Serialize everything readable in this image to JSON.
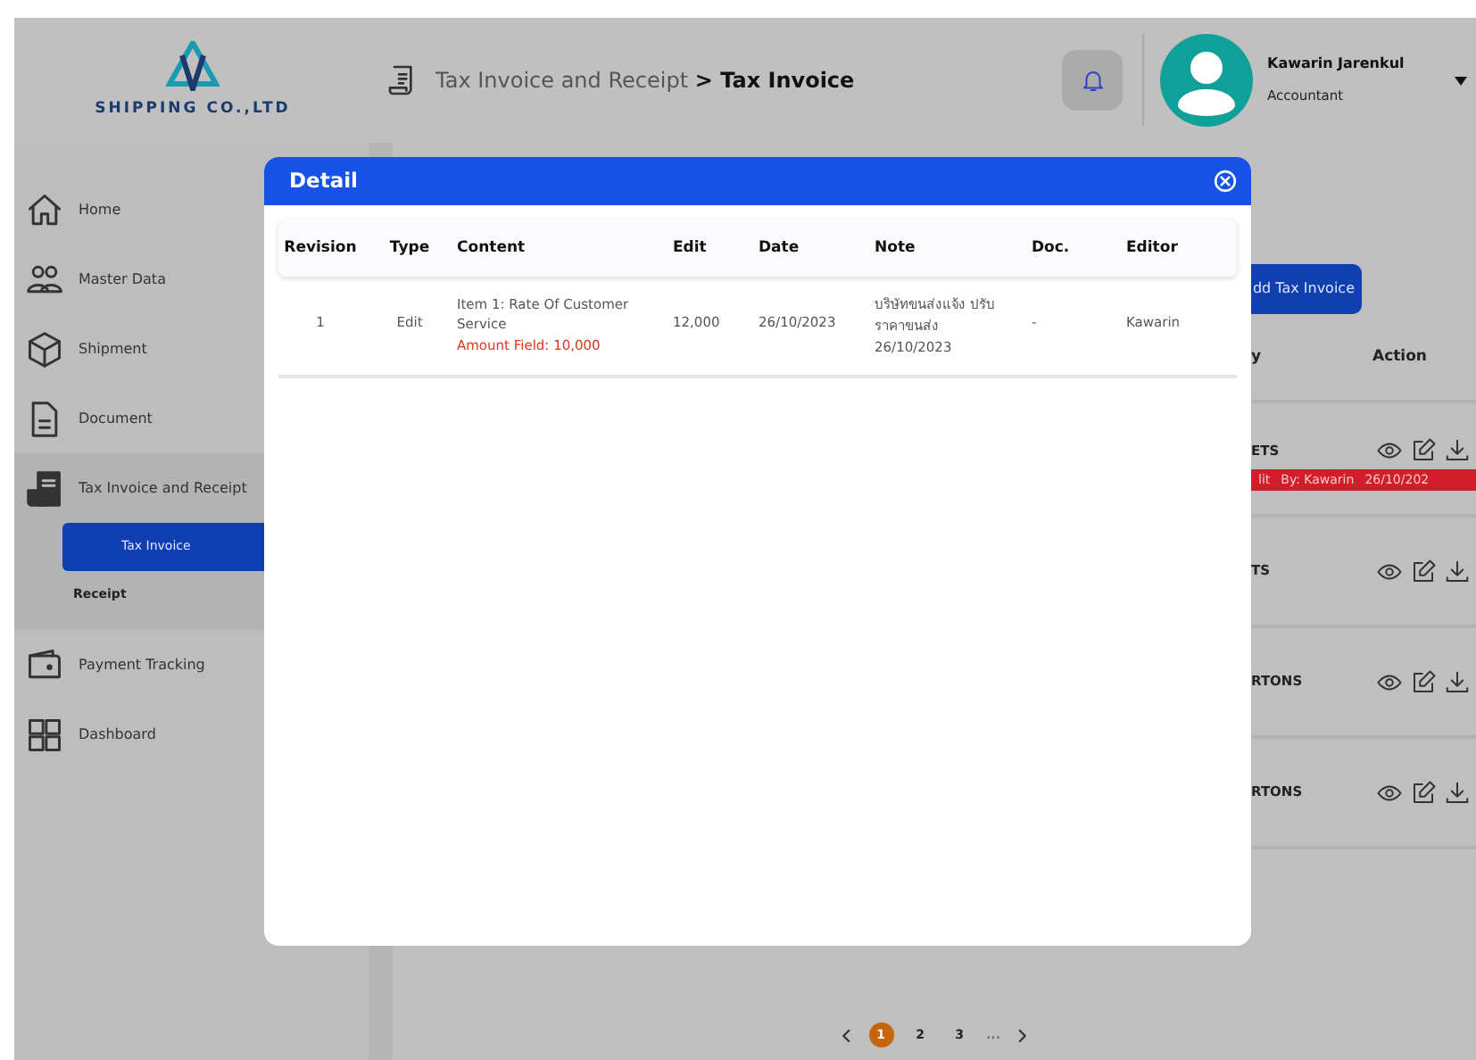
{
  "header": {
    "company": "SHIPPING CO.,LTD",
    "breadcrumb": {
      "parent": "Tax Invoice and Receipt",
      "separator": ">",
      "current": "Tax Invoice"
    },
    "user": {
      "name": "Kawarin Jarenkul",
      "role": "Accountant"
    }
  },
  "sidebar": {
    "items": [
      {
        "label": "Home",
        "selected": false
      },
      {
        "label": "Master Data",
        "selected": false
      },
      {
        "label": "Shipment",
        "selected": false
      },
      {
        "label": "Document",
        "selected": false
      },
      {
        "label": "Tax Invoice and Receipt",
        "selected": false,
        "expanded": true,
        "children": [
          {
            "label": "Tax Invoice",
            "selected": true
          },
          {
            "label": "Receipt",
            "selected": false
          }
        ]
      },
      {
        "label": "Payment Tracking",
        "selected": false
      },
      {
        "label": "Dashboard",
        "selected": false
      }
    ]
  },
  "background": {
    "add_button": "dd Tax Invoice",
    "columns": [
      "y",
      "Action"
    ],
    "rows": [
      {
        "column_1": "ETS",
        "edit_note": {
          "type": "lit",
          "by": "By: Kawarin",
          "date": "26/10/202"
        }
      },
      {
        "column_1": "TS"
      },
      {
        "column_1": "RTONS"
      },
      {
        "column_1": "RTONS"
      }
    ]
  },
  "pagination": {
    "pages": [
      {
        "label": "1",
        "selected": true
      },
      {
        "label": "2",
        "selected": false
      },
      {
        "label": "3",
        "selected": false
      }
    ],
    "ellipsis": "..."
  },
  "modal": {
    "title": "Detail",
    "columns": [
      "Revision",
      "Type",
      "Content",
      "Edit",
      "Date",
      "Note",
      "Doc.",
      "Editor"
    ],
    "rows": [
      {
        "revision": "1",
        "type": "Edit",
        "content": "Item 1: Rate Of Customer Service",
        "content_change": "Amount Field: 10,000",
        "edit": "12,000",
        "date": "26/10/2023",
        "note": "บริษัทขนส่งแจ้ง ปรับราคาขนส่ง 26/10/2023",
        "doc": "-",
        "editor": "Kawarin"
      }
    ]
  }
}
